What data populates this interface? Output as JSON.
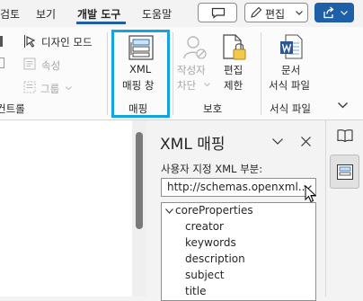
{
  "menu": {
    "tabs": [
      "검토",
      "보기",
      "개발 도구",
      "도움말"
    ],
    "active_tab": "개발 도구",
    "edit_button": "편집"
  },
  "ribbon": {
    "controls": {
      "design_mode": "디자인 모드",
      "properties": "속성",
      "group": "그룹",
      "label": "컨트롤"
    },
    "mapping": {
      "xml_pane_line1": "XML",
      "xml_pane_line2": "매핑 창",
      "label": "매핑"
    },
    "protect": {
      "block_authors_line1": "작성자",
      "block_authors_line2": "차단",
      "restrict_line1": "편집",
      "restrict_line2": "제한",
      "label": "보호"
    },
    "templates": {
      "doc_template_line1": "문서",
      "doc_template_line2": "서식 파일",
      "label": "서식 파일"
    }
  },
  "xml_pane": {
    "title": "XML 매핑",
    "custom_xml_label": "사용자 지정 XML 부분:",
    "selected_part": "http://schemas.openxml...",
    "tree": {
      "root": "coreProperties",
      "children": [
        "creator",
        "keywords",
        "description",
        "subject",
        "title"
      ]
    }
  },
  "colors": {
    "accent": "#1f5fa8",
    "highlight_box": "#13a3e0",
    "word_blue": "#2b5797"
  }
}
